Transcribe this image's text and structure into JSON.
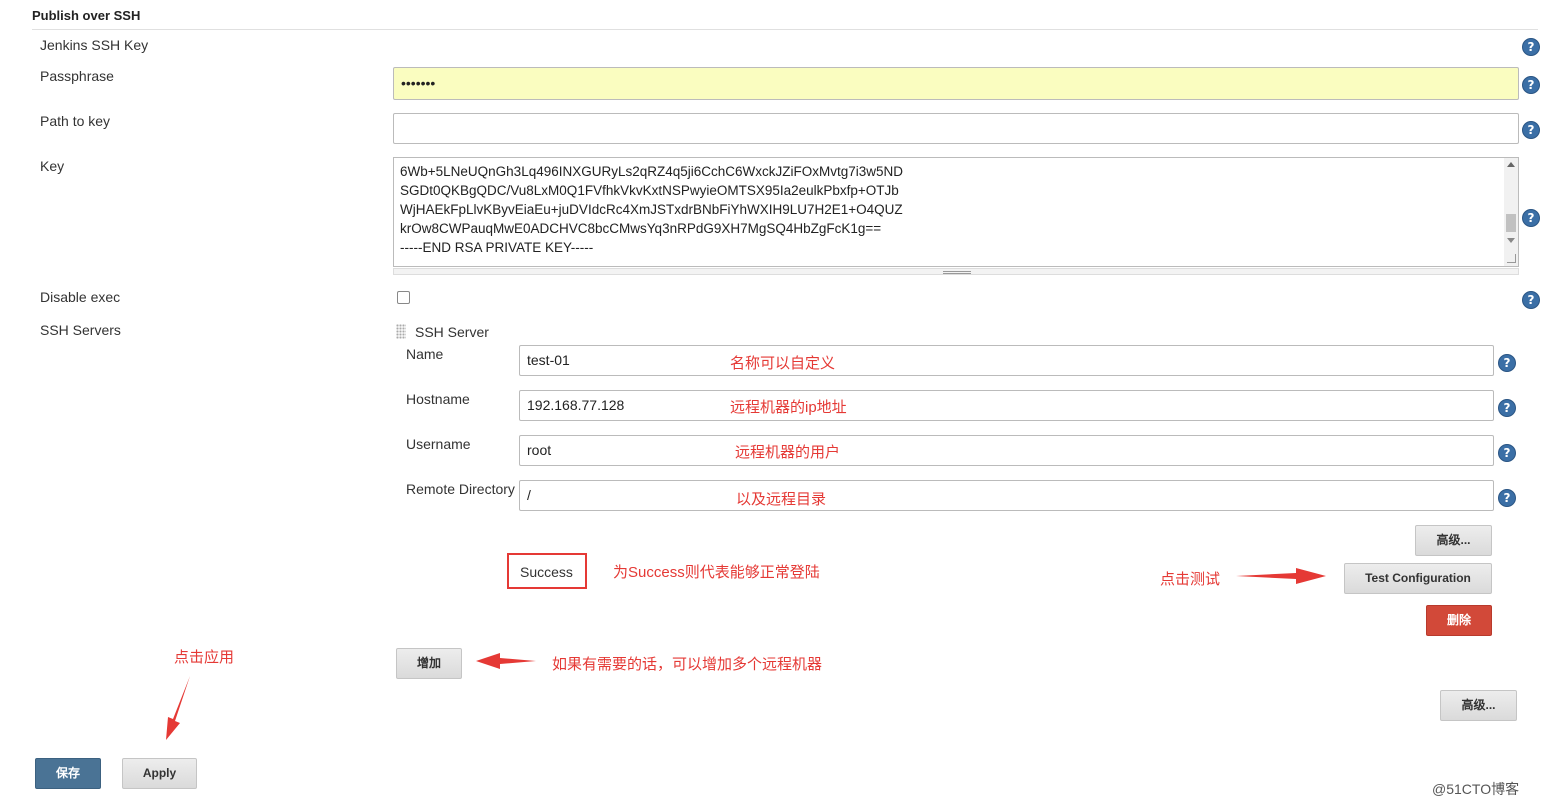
{
  "section": {
    "title": "Publish over SSH"
  },
  "fields": {
    "jenkins_ssh_key_label": "Jenkins SSH Key",
    "passphrase_label": "Passphrase",
    "passphrase_value": "•••••••",
    "path_to_key_label": "Path to key",
    "path_to_key_value": "",
    "key_label": "Key",
    "key_lines": [
      "6Wb+5LNeUQnGh3Lq496INXGURyLs2qRZ4q5ji6CchC6WxckJZiFOxMvtg7i3w5ND",
      "SGDt0QKBgQDC/Vu8LxM0Q1FVfhkVkvKxtNSPwyieOMTSX95Ia2eulkPbxfp+OTJb",
      "WjHAEkFpLlvKByvEiaEu+juDVIdcRc4XmJSTxdrBNbFiYhWXIH9LU7H2E1+O4QUZ",
      "krOw8CWPauqMwE0ADCHVC8bcCMwsYq3nRPdG9XH7MgSQ4HbZgFcK1g==",
      "-----END RSA PRIVATE KEY-----"
    ],
    "disable_exec_label": "Disable exec",
    "ssh_servers_label": "SSH Servers"
  },
  "ssh_server": {
    "header": "SSH Server",
    "name_label": "Name",
    "name_value": "test-01",
    "hostname_label": "Hostname",
    "hostname_value": "192.168.77.128",
    "username_label": "Username",
    "username_value": "root",
    "remote_dir_label": "Remote Directory",
    "remote_dir_value": "/",
    "advanced_label": "高级...",
    "test_config_label": "Test Configuration",
    "delete_label": "删除",
    "success_text": "Success"
  },
  "buttons": {
    "add_label": "增加",
    "advanced_label": "高级...",
    "save_label": "保存",
    "apply_label": "Apply"
  },
  "annotations": {
    "name_note": "名称可以自定义",
    "hostname_note": "远程机器的ip地址",
    "username_note": "远程机器的用户",
    "remote_dir_note": "以及远程目录",
    "success_note": "为Success则代表能够正常登陆",
    "test_note": "点击测试",
    "add_note": "如果有需要的话，可以增加多个远程机器",
    "apply_note": "点击应用"
  },
  "help_glyph": "?",
  "watermark": "@51CTO博客",
  "colors": {
    "annotation": "#e53935",
    "help_icon": "#3b6fa6",
    "passphrase_bg": "#fafdc0",
    "delete_button": "#d24939",
    "save_button": "#4a7395"
  }
}
